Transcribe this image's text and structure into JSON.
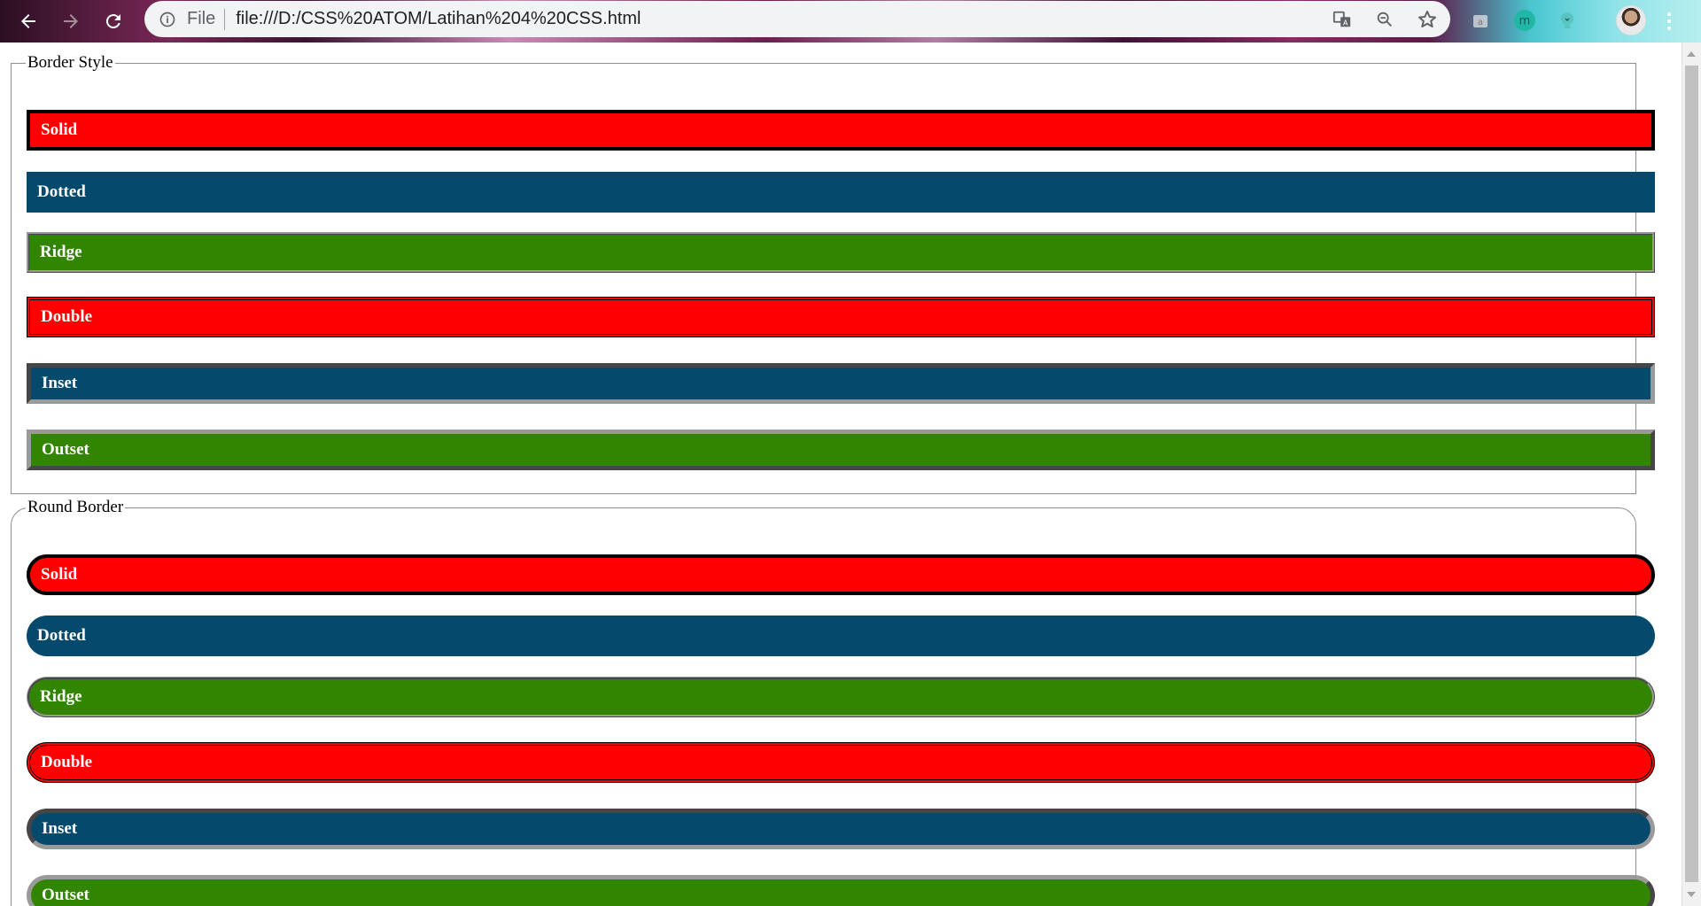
{
  "browser": {
    "scheme_label": "File",
    "url": "file:///D:/CSS%20ATOM/Latihan%204%20CSS.html",
    "icons": [
      "back-arrow-icon",
      "forward-arrow-icon",
      "reload-icon",
      "info-icon",
      "translate-icon",
      "zoom-out-icon",
      "bookmark-star-icon",
      "extension-icon",
      "avatar",
      "menu-icon"
    ]
  },
  "sections": [
    {
      "legend": "Border Style",
      "bars": [
        {
          "label": "Solid"
        },
        {
          "label": "Dotted"
        },
        {
          "label": "Ridge"
        },
        {
          "label": "Double"
        },
        {
          "label": "Inset"
        },
        {
          "label": "Outset"
        }
      ]
    },
    {
      "legend": "Round Border",
      "bars": [
        {
          "label": "Solid"
        },
        {
          "label": "Dotted"
        },
        {
          "label": "Ridge"
        },
        {
          "label": "Double"
        },
        {
          "label": "Inset"
        },
        {
          "label": "Outset"
        }
      ]
    }
  ],
  "colors": {
    "red": "#ff0000",
    "blue": "#054a6c",
    "green": "#318500",
    "border_black": "#000000",
    "border_gray": "#9a9a9a"
  }
}
